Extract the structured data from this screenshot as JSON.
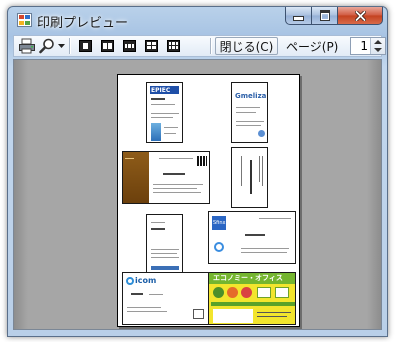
{
  "window": {
    "title": "印刷プレビュー",
    "caption_buttons": {
      "minimize_icon": "minimize-icon",
      "maximize_icon": "maximize-icon",
      "close_icon": "close-x-icon"
    }
  },
  "toolbar": {
    "print_icon": "printer-icon",
    "zoom_icon": "magnifier-icon",
    "zoom_dropdown_icon": "chevron-down-icon",
    "layouts": [
      "one-page-icon",
      "two-pages-icon",
      "three-pages-icon",
      "four-pages-icon",
      "six-pages-icon"
    ],
    "close_label": "閉じる(C)",
    "page_label": "ページ(P)",
    "page_value": "1"
  },
  "cards": {
    "card1_logo": "EPIEC",
    "card2_logo": "Gmeliza",
    "card6_logo": "Sfinx",
    "card7_logo": "icom",
    "card8_banner": "エコノミー・オフィス"
  },
  "colors": {
    "window_frame": "#b9d1ea",
    "close_button": "#c3411f",
    "preview_background": "#a6a6a6",
    "card_brown": "#7a4a12",
    "card_blue": "#2b66c4",
    "card_green": "#6fb12b",
    "card_yellow": "#f1e22a"
  }
}
